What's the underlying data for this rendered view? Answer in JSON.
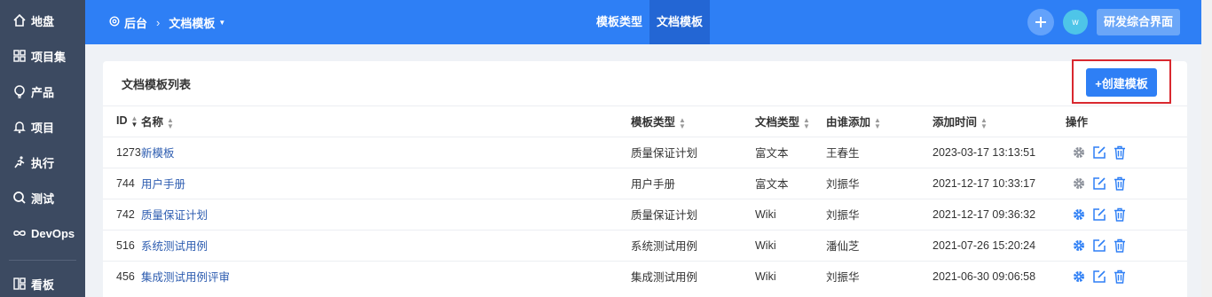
{
  "colors": {
    "topbar": "#2e7ff5",
    "sidebar": "#3c4a61",
    "link": "#2e5db0",
    "highlight_box": "#d9282f"
  },
  "sidebar": {
    "items": [
      {
        "label": "地盘",
        "icon": "home-icon"
      },
      {
        "label": "项目集",
        "icon": "grid-icon"
      },
      {
        "label": "产品",
        "icon": "lightbulb-icon"
      },
      {
        "label": "项目",
        "icon": "bell-icon"
      },
      {
        "label": "执行",
        "icon": "run-icon"
      },
      {
        "label": "测试",
        "icon": "search-icon"
      },
      {
        "label": "DevOps",
        "icon": "infinity-icon"
      },
      {
        "label": "看板",
        "icon": "kanban-icon"
      }
    ]
  },
  "header": {
    "breadcrumb_root": "后台",
    "breadcrumb_current": "文档模板",
    "tabs": [
      {
        "label": "模板类型"
      },
      {
        "label": "文档模板"
      }
    ],
    "avatar_letter": "w",
    "right_button": "研发综合界面"
  },
  "card": {
    "title": "文档模板列表",
    "create_button": "+创建模板",
    "columns": [
      "ID",
      "名称",
      "模板类型",
      "文档类型",
      "由谁添加",
      "添加时间",
      "操作"
    ],
    "rows": [
      {
        "id": "1273",
        "name": "新模板",
        "type": "质量保证计划",
        "doc_type": "富文本",
        "creator": "王春生",
        "time": "2023-03-17 13:13:51",
        "gear_active": false
      },
      {
        "id": "744",
        "name": "用户手册",
        "type": "用户手册",
        "doc_type": "富文本",
        "creator": "刘振华",
        "time": "2021-12-17 10:33:17",
        "gear_active": false
      },
      {
        "id": "742",
        "name": "质量保证计划",
        "type": "质量保证计划",
        "doc_type": "Wiki",
        "creator": "刘振华",
        "time": "2021-12-17 09:36:32",
        "gear_active": true
      },
      {
        "id": "516",
        "name": "系统测试用例",
        "type": "系统测试用例",
        "doc_type": "Wiki",
        "creator": "潘仙芝",
        "time": "2021-07-26 15:20:24",
        "gear_active": true
      },
      {
        "id": "456",
        "name": "集成测试用例评审",
        "type": "集成测试用例",
        "doc_type": "Wiki",
        "creator": "刘振华",
        "time": "2021-06-30 09:06:58",
        "gear_active": true
      }
    ]
  }
}
